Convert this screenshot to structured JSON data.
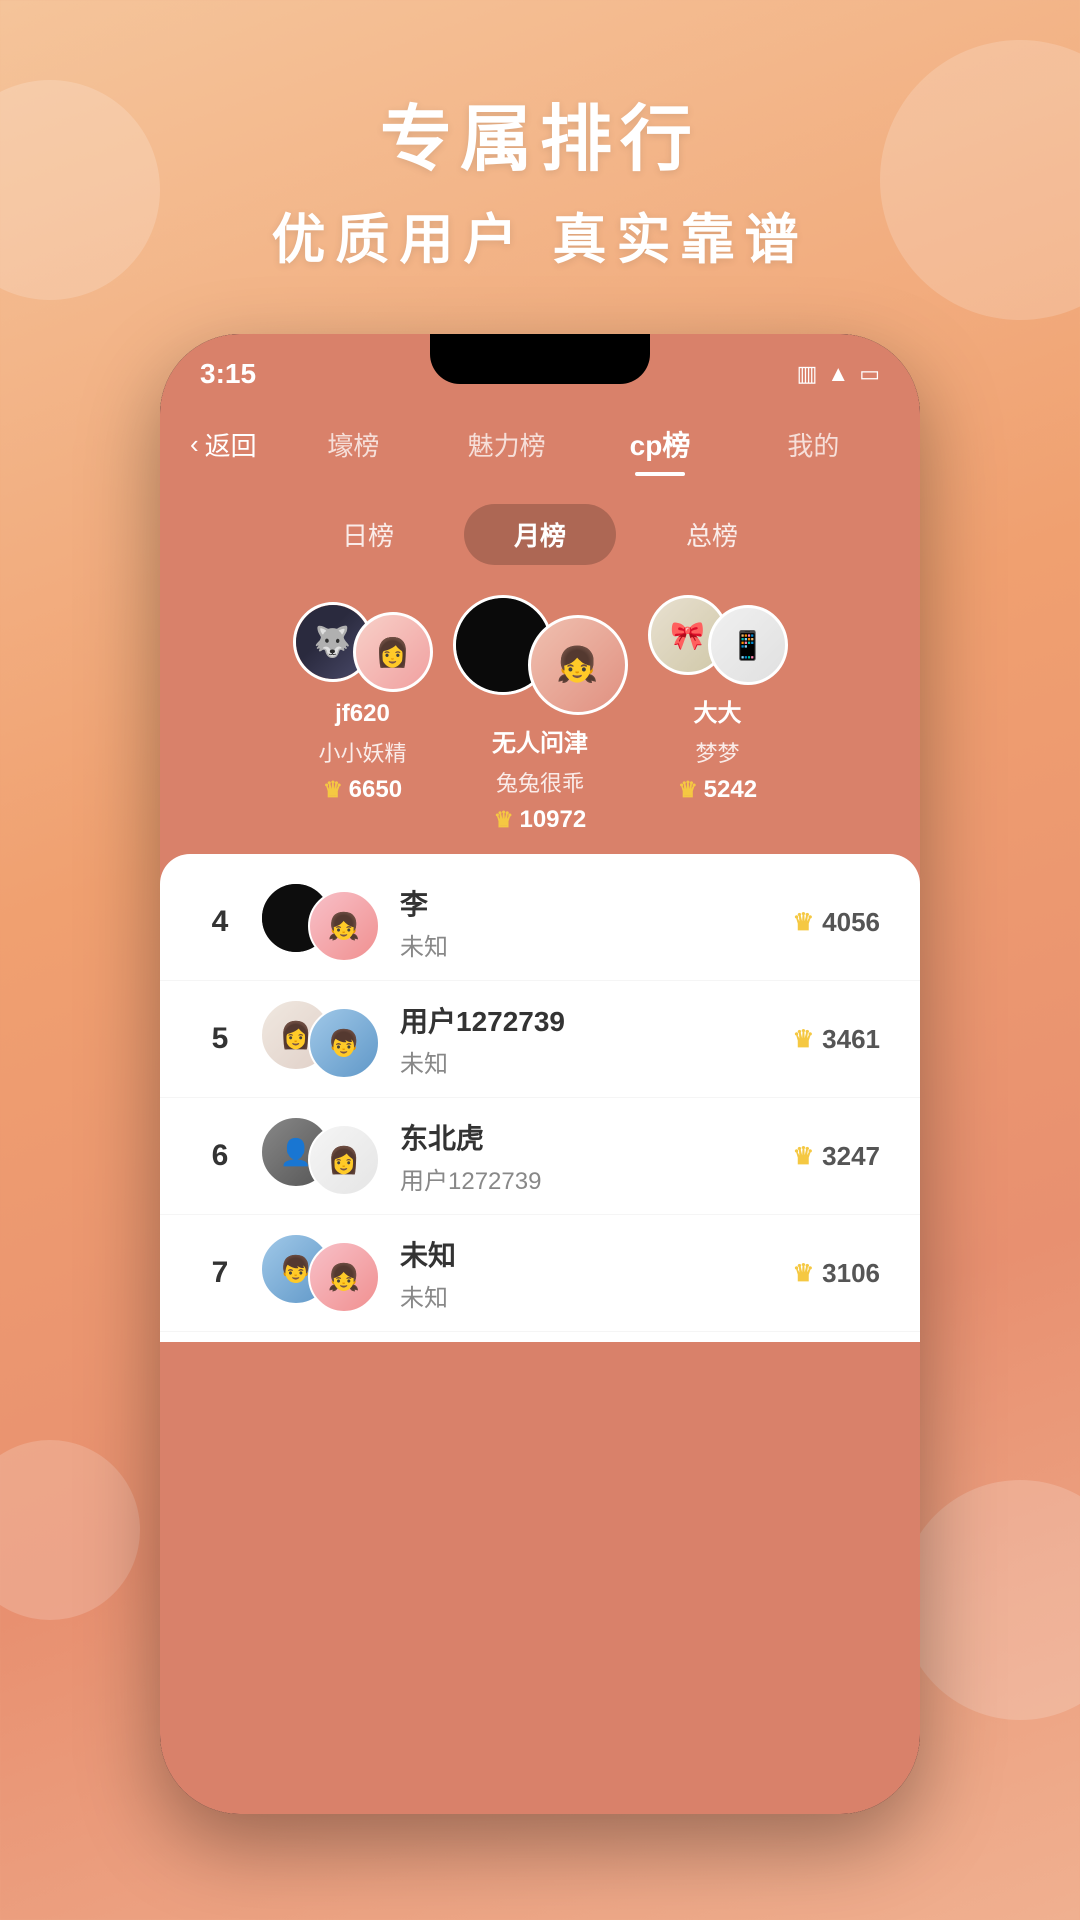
{
  "background": {
    "title_main": "专属排行",
    "title_sub": "优质用户 真实靠谱"
  },
  "status_bar": {
    "time": "3:15",
    "icons": [
      "vibrate",
      "wifi",
      "battery"
    ]
  },
  "nav": {
    "back_label": "返回",
    "tabs": [
      {
        "id": "壕榜",
        "label": "壕榜",
        "active": false
      },
      {
        "id": "魅力榜",
        "label": "魅力榜",
        "active": false
      },
      {
        "id": "cp榜",
        "label": "cp榜",
        "active": true
      },
      {
        "id": "我的",
        "label": "我的",
        "active": false
      }
    ]
  },
  "period_tabs": [
    {
      "id": "日榜",
      "label": "日榜",
      "active": false
    },
    {
      "id": "月榜",
      "label": "月榜",
      "active": true
    },
    {
      "id": "总榜",
      "label": "总榜",
      "active": false
    }
  ],
  "podium": [
    {
      "rank": 2,
      "name1": "jf620",
      "name2": "小小妖精",
      "score": 6650,
      "position": "left"
    },
    {
      "rank": 1,
      "name1": "无人问津",
      "name2": "兔兔很乖",
      "score": 10972,
      "position": "center"
    },
    {
      "rank": 3,
      "name1": "大大",
      "name2": "梦梦",
      "score": 5242,
      "position": "right"
    }
  ],
  "list": [
    {
      "rank": 4,
      "name1": "李",
      "name2": "未知",
      "score": 4056
    },
    {
      "rank": 5,
      "name1": "用户1272739",
      "name2": "未知",
      "score": 3461
    },
    {
      "rank": 6,
      "name1": "东北虎",
      "name2": "用户1272739",
      "score": 3247
    },
    {
      "rank": 7,
      "name1": "未知",
      "name2": "未知",
      "score": 3106
    }
  ],
  "crown_icon": "♛",
  "back_arrow": "‹"
}
